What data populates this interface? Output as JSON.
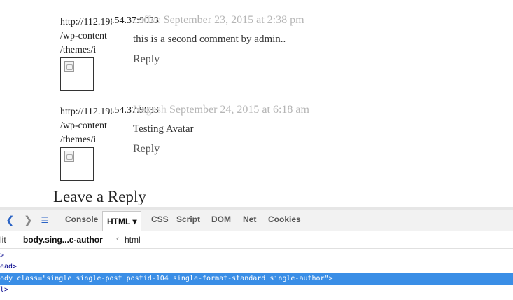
{
  "comments": [
    {
      "avatar_url_lines": [
        "http://112.196.54.37:9033",
        "/wp-content",
        "/themes/i"
      ],
      "author": "coffee",
      "date": "September 23, 2015 at 2:38 pm",
      "text": "this is a second comment by admin..",
      "reply_label": "Reply"
    },
    {
      "avatar_url_lines": [
        "http://112.196.54.37:9033",
        "/wp-content",
        "/themes/i"
      ],
      "author": "Nagesh",
      "date": "September 24, 2015 at 6:18 am",
      "text": "Testing Avatar",
      "reply_label": "Reply"
    }
  ],
  "leave_reply": "Leave a Reply",
  "devtools": {
    "tabs": [
      "Console",
      "HTML ▾",
      "CSS",
      "Script",
      "DOM",
      "Net",
      "Cookies"
    ],
    "active_tab": "HTML ▾",
    "breadcrumb": {
      "edit": "lit",
      "current": "body.sing...e-author",
      "parent": "html"
    },
    "tree_lines": [
      ">",
      "ead>",
      "ody class=\"single single-post postid-104 single-format-standard single-author\">",
      "l>"
    ],
    "selected_line_index": 2,
    "accent_color": "#3a8ee6"
  }
}
